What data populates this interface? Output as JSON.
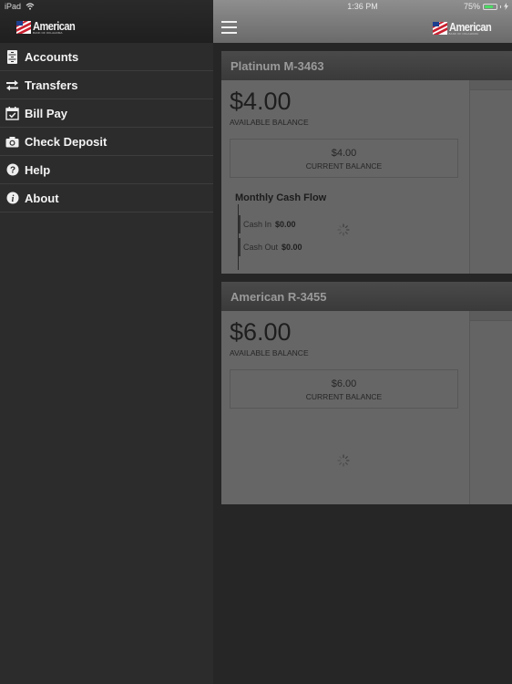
{
  "status_bar": {
    "device": "iPad",
    "time": "1:36 PM",
    "battery": "75%",
    "battery_level": 0.75
  },
  "brand": {
    "name": "American",
    "tagline": "BANK OF OKLAHOMA"
  },
  "sidebar": {
    "items": [
      {
        "label": "Accounts",
        "icon": "cabinet-icon"
      },
      {
        "label": "Transfers",
        "icon": "transfer-arrows-icon"
      },
      {
        "label": "Bill Pay",
        "icon": "calendar-check-icon"
      },
      {
        "label": "Check Deposit",
        "icon": "camera-icon"
      },
      {
        "label": "Help",
        "icon": "question-icon"
      },
      {
        "label": "About",
        "icon": "info-icon"
      }
    ]
  },
  "accounts": [
    {
      "name": "Platinum M-3463",
      "available_balance": "$4.00",
      "available_label": "AVAILABLE BALANCE",
      "current_balance": "$4.00",
      "current_label": "CURRENT BALANCE",
      "cash_flow": {
        "title": "Monthly Cash Flow",
        "cash_in_label": "Cash In",
        "cash_in": "$0.00",
        "cash_out_label": "Cash Out",
        "cash_out": "$0.00"
      }
    },
    {
      "name": "American R-3455",
      "available_balance": "$6.00",
      "available_label": "AVAILABLE BALANCE",
      "current_balance": "$6.00",
      "current_label": "CURRENT BALANCE"
    }
  ],
  "colors": {
    "battery_green": "#4cd964",
    "sidebar_bg": "#2c2c2c",
    "flag_red": "#c8202f",
    "flag_blue": "#1d3f8f"
  }
}
